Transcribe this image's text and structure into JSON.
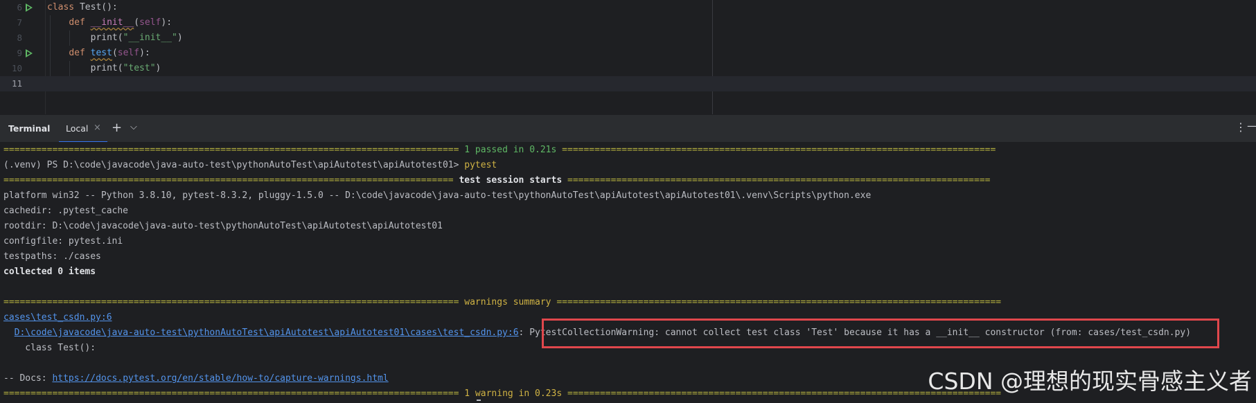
{
  "editor": {
    "lines": [
      {
        "num": "6",
        "run": true,
        "tokens": [
          [
            "kw",
            "class "
          ],
          [
            "txt",
            "Test():"
          ]
        ]
      },
      {
        "num": "7",
        "run": false,
        "tokens": [
          [
            "txt",
            "    "
          ],
          [
            "kw",
            "def "
          ],
          [
            "magic",
            "__init__"
          ],
          [
            "txt",
            "("
          ],
          [
            "slf",
            "self"
          ],
          [
            "txt",
            "):"
          ]
        ]
      },
      {
        "num": "8",
        "run": false,
        "tokens": [
          [
            "txt",
            "        print("
          ],
          [
            "str",
            "\"__init__\""
          ],
          [
            "txt",
            ")"
          ]
        ]
      },
      {
        "num": "9",
        "run": true,
        "tokens": [
          [
            "txt",
            "    "
          ],
          [
            "kw",
            "def "
          ],
          [
            "fn",
            "test"
          ],
          [
            "txt",
            "("
          ],
          [
            "slf",
            "self"
          ],
          [
            "txt",
            "):"
          ]
        ]
      },
      {
        "num": "10",
        "run": false,
        "tokens": [
          [
            "txt",
            "        print("
          ],
          [
            "str",
            "\"test\""
          ],
          [
            "txt",
            ")"
          ]
        ]
      },
      {
        "num": "11",
        "run": false,
        "tokens": []
      }
    ]
  },
  "terminal": {
    "title": "Terminal",
    "tab_label": "Local",
    "close_glyph": "×",
    "add_glyph": "+",
    "dropdown_glyph": "⌵",
    "more_glyph": "⋮",
    "minimize_glyph": "—",
    "sep_left_passed": "==================================================================================== ",
    "passed_text": "1 passed in 0.21s",
    "sep_right_passed": " ================================================================================",
    "prompt": "(.venv) PS D:\\code\\javacode\\java-auto-test\\pythonAutoTest\\apiAutotest\\apiAutotest01> ",
    "command": "pytest",
    "sep_left_session": "=================================================================================== ",
    "session_text": "test session starts",
    "sep_right_session": " ==============================================================================",
    "platform": "platform win32 -- Python 3.8.10, pytest-8.3.2, pluggy-1.5.0 -- D:\\code\\javacode\\java-auto-test\\pythonAutoTest\\apiAutotest\\apiAutotest01\\.venv\\Scripts\\python.exe",
    "cachedir": "cachedir: .pytest_cache",
    "rootdir": "rootdir: D:\\code\\javacode\\java-auto-test\\pythonAutoTest\\apiAutotest\\apiAutotest01",
    "configfile": "configfile: pytest.ini",
    "testpaths": "testpaths: ./cases",
    "collected": "collected 0 items",
    "sep_left_warn": "==================================================================================== ",
    "warn_summary_text": "warnings summary",
    "sep_right_warn": " ==================================================================================",
    "warn_file_link": "cases\\test_csdn.py:6",
    "warn_path_link": "D:\\code\\javacode\\java-auto-test\\pythonAutoTest\\apiAutotest\\apiAutotest01\\cases\\test_csdn.py:6",
    "warn_message": "PytestCollectionWarning: cannot collect test class 'Test' because it has a __init__ constructor (from: cases/test_csdn.py)",
    "warn_code": "    class Test():",
    "docs_label": "-- Docs: ",
    "docs_link": "https://docs.pytest.org/en/stable/how-to/capture-warnings.html",
    "sep_left_final": "==================================================================================== ",
    "final_text": "1 warning in 0.23s",
    "sep_right_final": " ================================================================================"
  },
  "watermark": "CSDN @理想的现实骨感主义者",
  "colors": {
    "accent": "#3574f0",
    "highlight_box": "#e0474c",
    "run_icon": "#5fb865"
  }
}
